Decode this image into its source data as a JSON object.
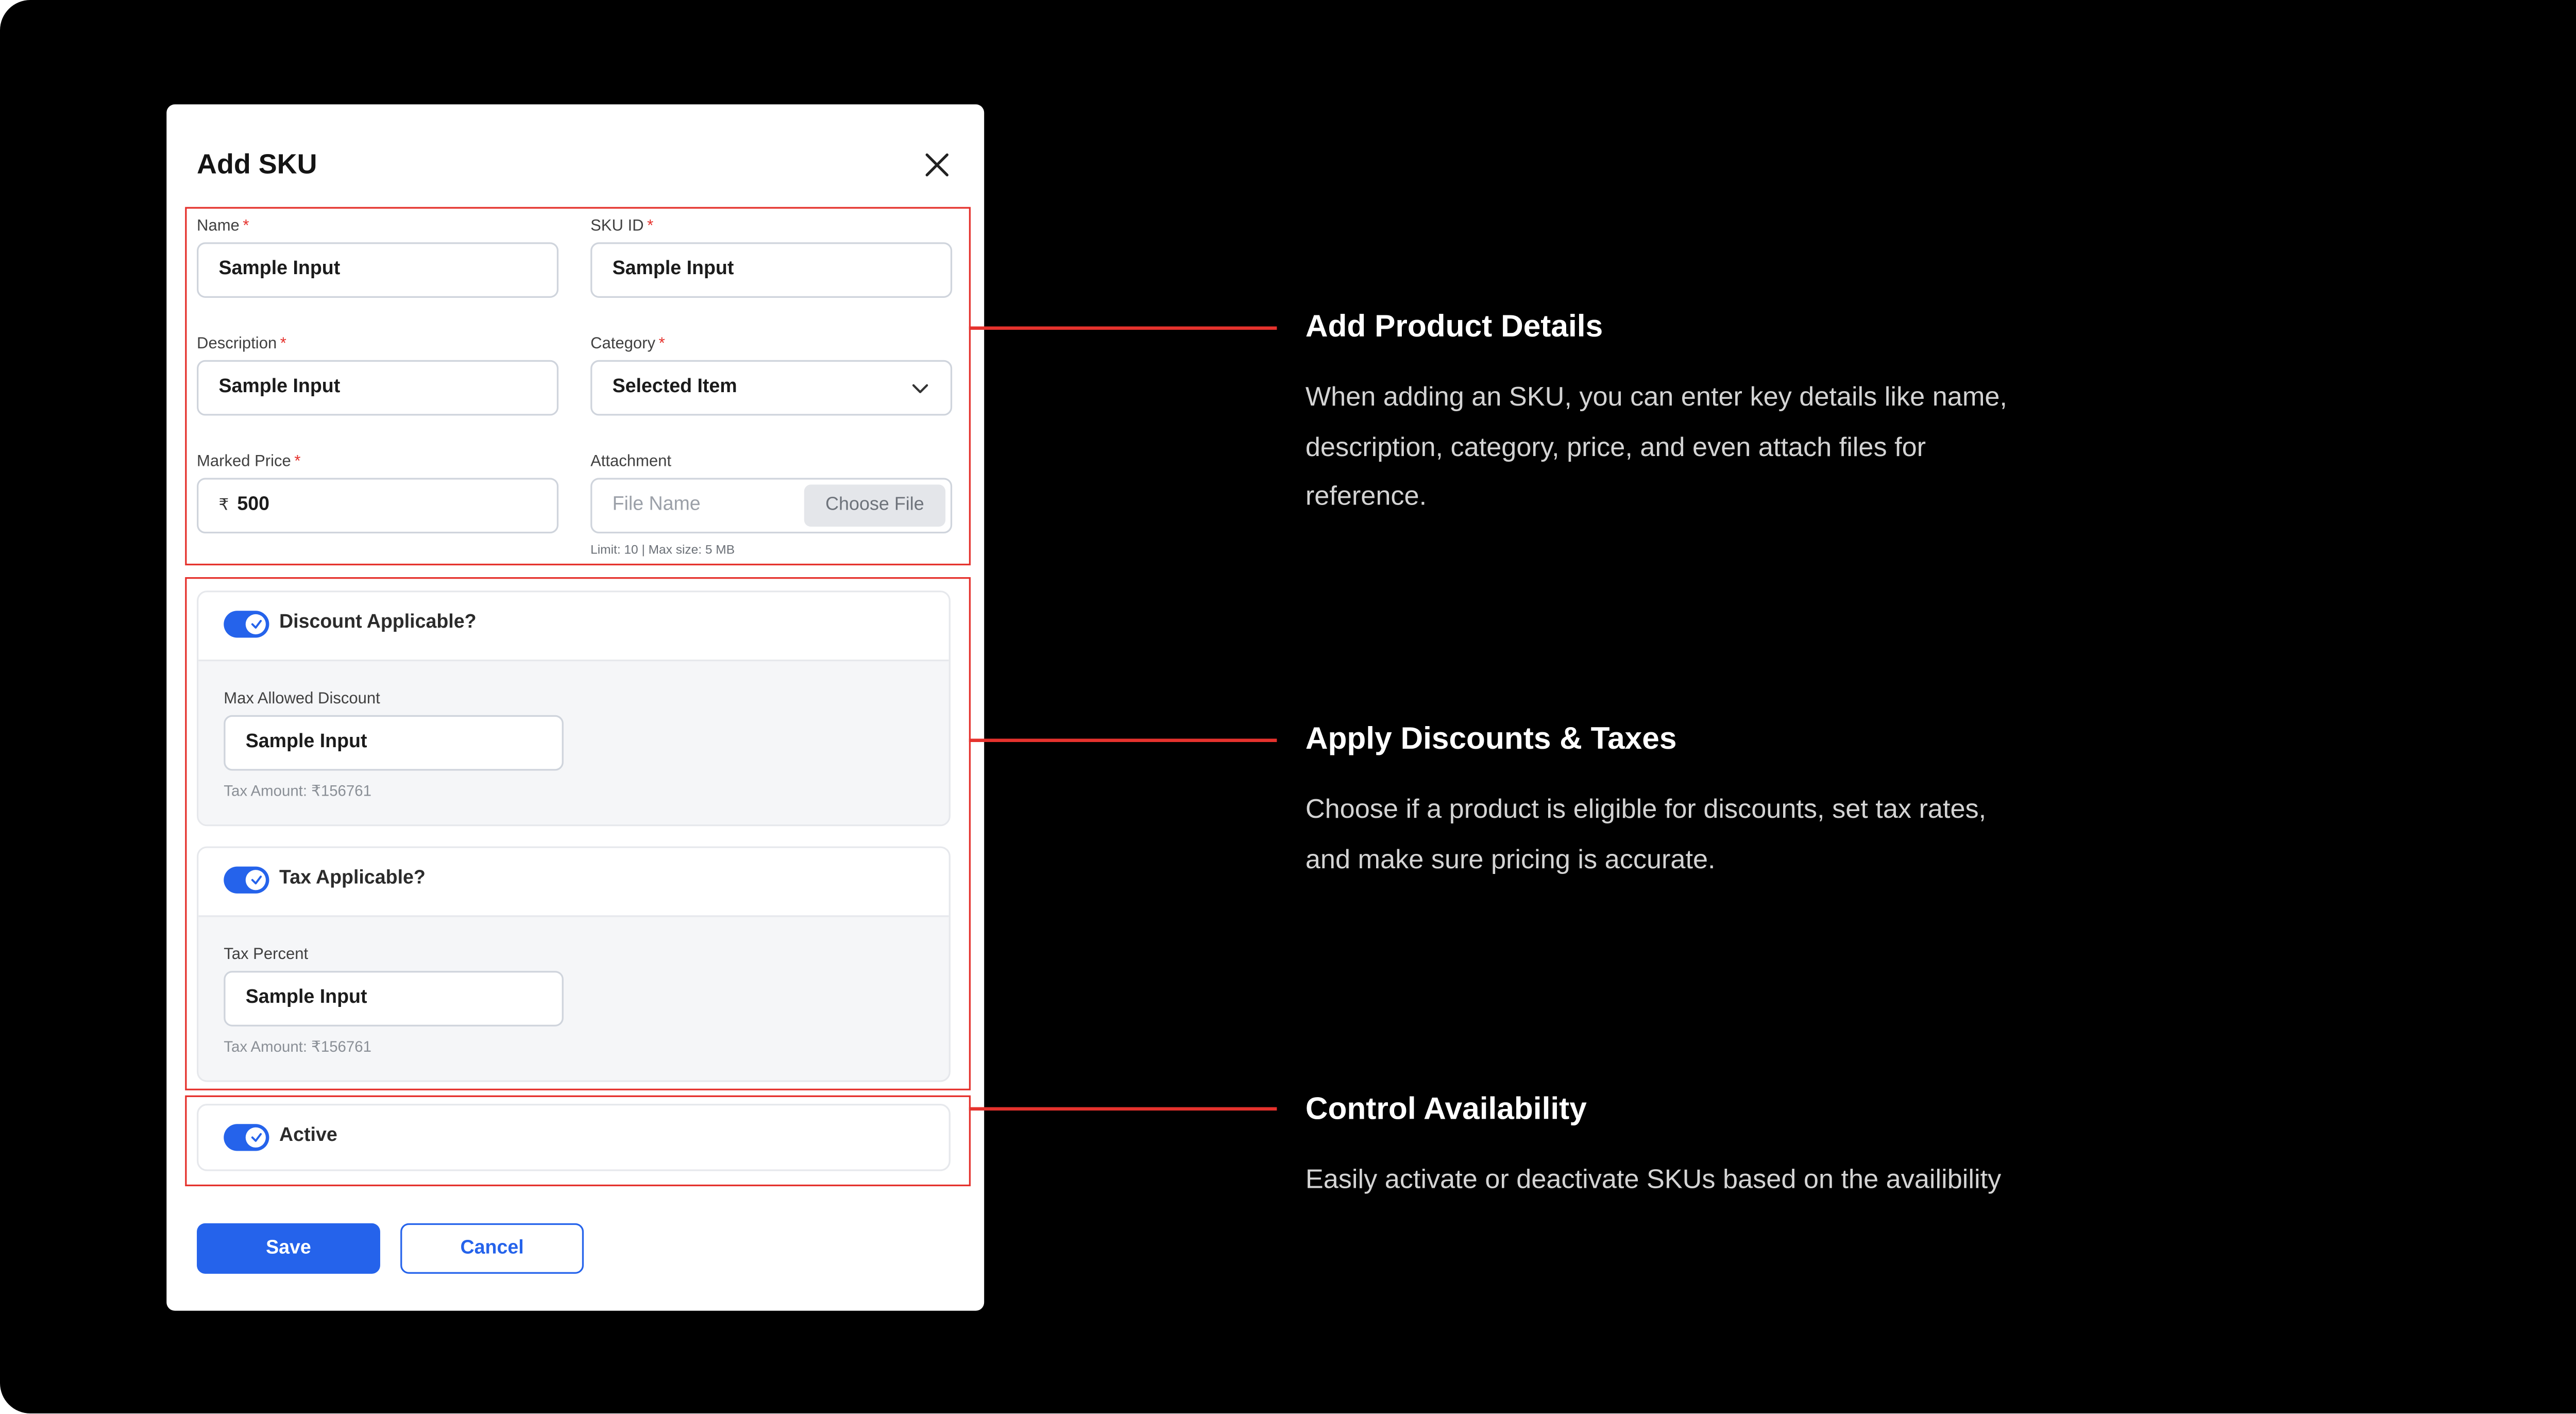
{
  "dialog": {
    "title": "Add SKU",
    "fields": {
      "name": {
        "label": "Name",
        "required": "*",
        "value": "Sample Input"
      },
      "sku_id": {
        "label": "SKU ID",
        "required": "*",
        "value": "Sample Input"
      },
      "description": {
        "label": "Description",
        "required": "*",
        "value": "Sample Input"
      },
      "category": {
        "label": "Category",
        "required": "*",
        "value": "Selected Item"
      },
      "marked_price": {
        "label": "Marked Price",
        "required": "*",
        "currency": "₹",
        "value": "500"
      },
      "attachment": {
        "label": "Attachment",
        "placeholder": "File Name",
        "button": "Choose File",
        "hint": "Limit: 10  |  Max size: 5 MB"
      }
    },
    "discount": {
      "toggle_label": "Discount Applicable?",
      "field_label": "Max Allowed Discount",
      "value": "Sample Input",
      "tax_amount": "Tax Amount: ₹156761"
    },
    "tax": {
      "toggle_label": "Tax Applicable?",
      "field_label": "Tax Percent",
      "value": "Sample Input",
      "tax_amount": "Tax Amount: ₹156761"
    },
    "active": {
      "toggle_label": "Active"
    },
    "save_label": "Save",
    "cancel_label": "Cancel"
  },
  "annotations": [
    {
      "title": "Add Product Details",
      "description": "When adding an SKU, you can enter key details like name, description, category, price, and even attach files for reference."
    },
    {
      "title": "Apply Discounts & Taxes",
      "description": "Choose if a product is eligible for discounts, set tax rates, and make sure pricing is accurate."
    },
    {
      "title": "Control Availability",
      "description": "Easily activate or deactivate SKUs based on the availibility"
    }
  ],
  "colors": {
    "background": "#000000",
    "primary": "#2563eb",
    "highlight": "#e5322d"
  }
}
